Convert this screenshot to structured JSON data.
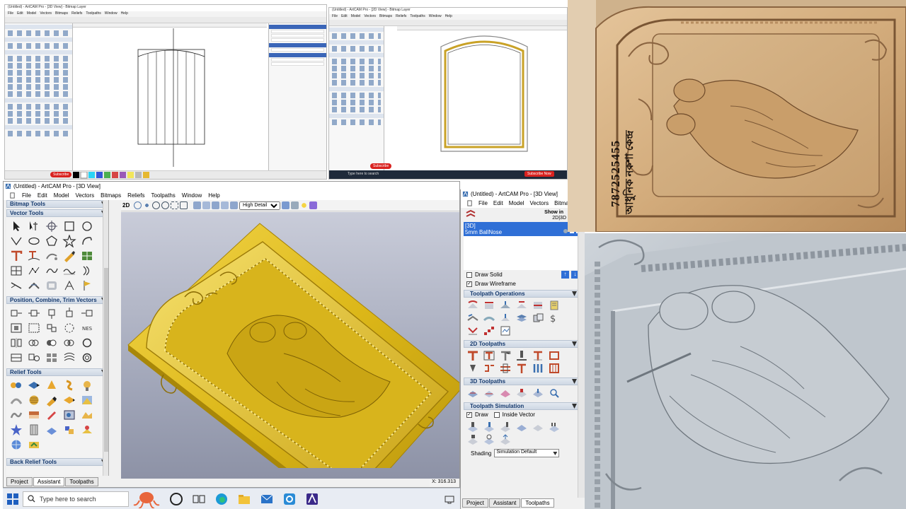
{
  "main_window": {
    "title": "(Untitled) - ArtCAM Pro - [3D View]",
    "menu": [
      "File",
      "Edit",
      "Model",
      "Vectors",
      "Bitmaps",
      "Reliefs",
      "Toolpaths",
      "Window",
      "Help"
    ],
    "sections": {
      "bitmap_tools": "Bitmap Tools",
      "vector_tools": "Vector Tools",
      "position_tools": "Position, Combine, Trim Vectors",
      "relief_tools": "Relief Tools",
      "back_relief_tools": "Back Relief Tools"
    },
    "tabs": [
      "Project",
      "Assistant",
      "Toolpaths"
    ],
    "toolbar_2d": "2D",
    "detail_select": "High Detail",
    "coordinate": "X: 316.313"
  },
  "right_window": {
    "title": "(Untitled) - ArtCAM Pro - [3D View]",
    "menu": [
      "File",
      "Edit",
      "Model",
      "Vectors",
      "Bitmaps"
    ],
    "show_in": "Show in",
    "show_in_sub": "2D|3D",
    "layer_3d": "[3D]",
    "layer_tool": "5mm BallNose",
    "draw_solid": "Draw Solid",
    "draw_wireframe": "Draw Wireframe",
    "sections": {
      "toolpath_operations": "Toolpath Operations",
      "toolpaths_2d": "2D Toolpaths",
      "toolpaths_3d": "3D Toolpaths",
      "toolpath_simulation": "Toolpath Simulation"
    },
    "draw": "Draw",
    "inside_vector": "Inside Vector",
    "shading_label": "Shading",
    "shading_value": "Simulation Default",
    "tabs": [
      "Project",
      "Assistant",
      "Toolpaths"
    ]
  },
  "taskbar": {
    "search_placeholder": "Type here to search"
  },
  "mini_left": {
    "title": "(Untitled) - ArtCAM Pro - [3D View] - Bitmap Layer",
    "menu": [
      "File",
      "Edit",
      "Model",
      "Vectors",
      "Bitmaps",
      "Reliefs",
      "Toolpaths",
      "Window",
      "Help"
    ],
    "subscribe": "Subscribe"
  },
  "mini_right": {
    "title": "(Untitled) - ArtCAM Pro - [2D View] - Bitmap Layer",
    "menu": [
      "File",
      "Edit",
      "Model",
      "Vectors",
      "Bitmaps",
      "Reliefs",
      "Toolpaths",
      "Window",
      "Help"
    ],
    "subscribe": "Subscribe",
    "subscribe_now": "Subscribe Now",
    "search": "Type here to search"
  },
  "photo_text": {
    "phone": "7872525455",
    "bengali": "আধুনিক নকশা কেন্দ্র"
  },
  "colors": {
    "relief_gold": "#e3bf1f",
    "background_blue": "#a7abc0",
    "selection_blue": "#2f6fd6",
    "wood": "#d7b185",
    "silver": "#b5bcc3"
  }
}
